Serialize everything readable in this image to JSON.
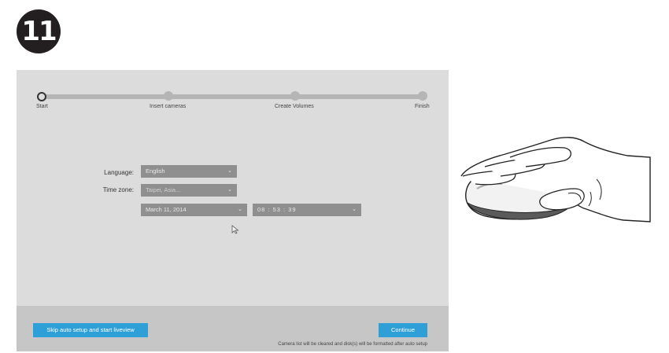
{
  "step_badge": "11",
  "wizard": {
    "steps": [
      "Start",
      "Insert cameras",
      "Create Volumes",
      "Finish"
    ],
    "current_step": 0
  },
  "form": {
    "language_label": "Language:",
    "language_value": "English",
    "timezone_label": "Time zone:",
    "timezone_value": "Taipei, Asia...",
    "date_value": "March 11, 2014",
    "time_value": "08 : 53 : 39"
  },
  "footer": {
    "skip_button": "Skip auto setup and start liveview",
    "continue_button": "Continue",
    "note": "Camera list will be cleared and disk(s) will be formatted after auto setup"
  },
  "colors": {
    "accent": "#2f9fd8",
    "screen_bg": "#dcdcdc",
    "footer_bg": "#c6c6c6",
    "select_bg": "#8f8f8f",
    "badge_bg": "#231f20"
  },
  "icons": [
    "chevron-down-icon",
    "cursor-icon",
    "hand-mouse-icon"
  ]
}
